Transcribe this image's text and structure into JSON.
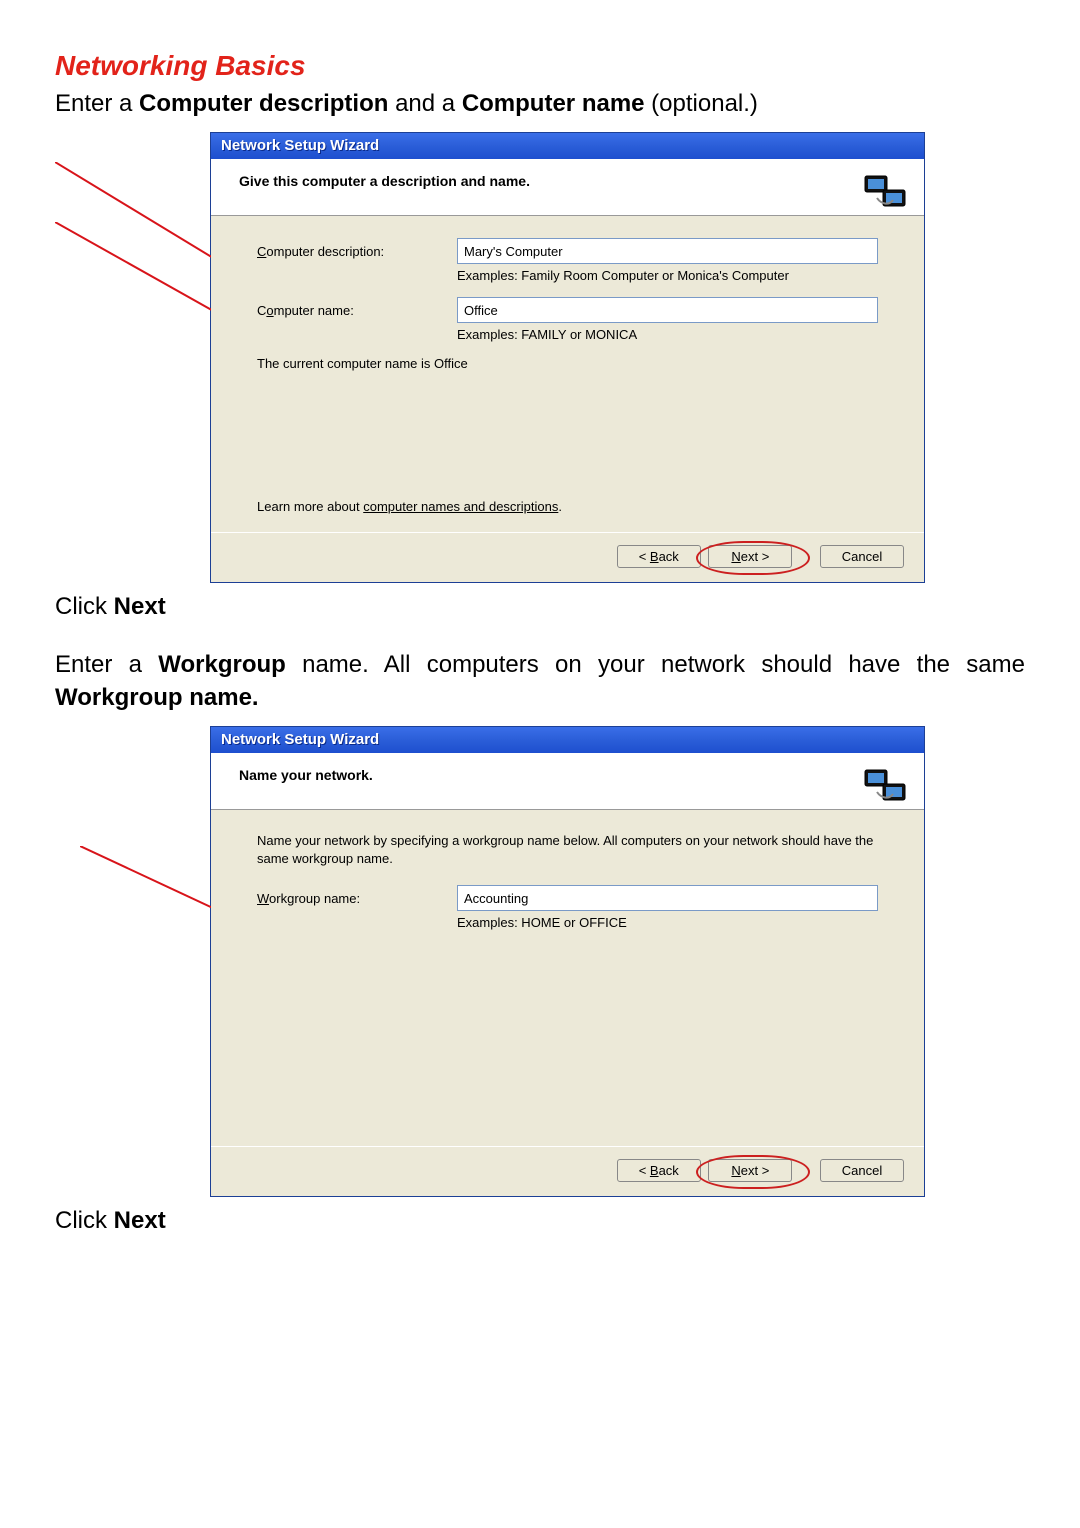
{
  "page": {
    "heading": "Networking Basics",
    "instr1_prefix": "Enter a ",
    "instr1_b1": "Computer description",
    "instr1_mid": " and a ",
    "instr1_b2": "Computer name",
    "instr1_suffix": " (optional.)",
    "click_prefix": "Click ",
    "click_next": "Next",
    "instr2_prefix": "Enter a ",
    "instr2_b1": "Workgroup",
    "instr2_mid": " name.  All computers on your network should have the same ",
    "instr2_b2": "Workgroup name."
  },
  "dialog1": {
    "title": "Network Setup Wizard",
    "header": "Give this computer a description and name.",
    "desc_label_u": "C",
    "desc_label_rest": "omputer description:",
    "desc_value": "Mary's Computer",
    "desc_example": "Examples: Family Room Computer or Monica's Computer",
    "name_label_pre": "C",
    "name_label_u": "o",
    "name_label_rest": "mputer name:",
    "name_value": "Office",
    "name_example": "Examples: FAMILY or MONICA",
    "current_pre": "The current computer name is   ",
    "current_val": "Office",
    "learn_pre": "Learn more about ",
    "learn_link": "computer names and descriptions",
    "learn_post": ".",
    "back_u": "B",
    "back_rest": "ack",
    "next_u": "N",
    "next_rest": "ext >",
    "cancel": "Cancel"
  },
  "dialog2": {
    "title": "Network Setup Wizard",
    "header": "Name your network.",
    "intro": "Name your network by specifying a workgroup name below. All computers on your network should have the same workgroup name.",
    "wg_label_u": "W",
    "wg_label_rest": "orkgroup name:",
    "wg_value": "Accounting",
    "wg_example": "Examples: HOME or OFFICE",
    "back_u": "B",
    "back_rest": "ack",
    "next_u": "N",
    "next_rest": "ext >",
    "cancel": "Cancel"
  }
}
